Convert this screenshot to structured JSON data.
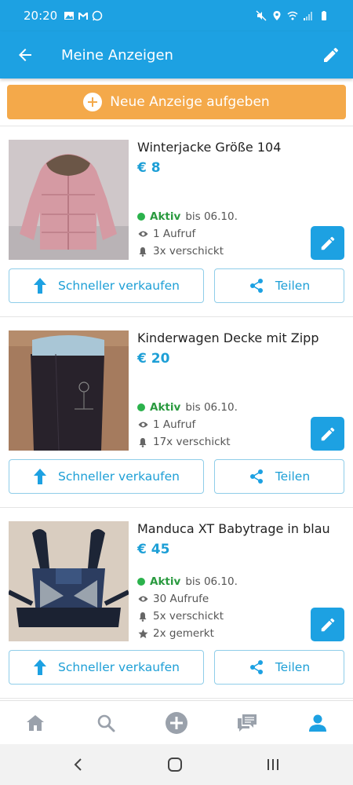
{
  "status_bar": {
    "time": "20:20"
  },
  "app_bar": {
    "title": "Meine Anzeigen"
  },
  "new_ad_button": {
    "label": "Neue Anzeige aufgeben"
  },
  "listings": [
    {
      "title": "Winterjacke Größe 104",
      "price": "€ 8",
      "status": "Aktiv",
      "until": "bis 06.10.",
      "views": "1 Aufruf",
      "sent": "3x verschickt",
      "sell_label": "Schneller verkaufen",
      "share_label": "Teilen"
    },
    {
      "title": "Kinderwagen Decke mit Zipp",
      "price": "€ 20",
      "status": "Aktiv",
      "until": "bis 06.10.",
      "views": "1 Aufruf",
      "sent": "17x verschickt",
      "sell_label": "Schneller verkaufen",
      "share_label": "Teilen"
    },
    {
      "title": "Manduca XT Babytrage in blau",
      "price": "€ 45",
      "status": "Aktiv",
      "until": "bis 06.10.",
      "views": "30 Aufrufe",
      "sent": "5x verschickt",
      "saved": "2x gemerkt",
      "sell_label": "Schneller verkaufen",
      "share_label": "Teilen"
    }
  ],
  "bottom_nav": [
    "home-icon",
    "search-icon",
    "add-circle-icon",
    "messages-icon",
    "profile-icon"
  ],
  "colors": {
    "primary": "#1da1e2",
    "accent_orange": "#f4a94a",
    "active_green": "#2bb24c",
    "price_blue": "#1d9fd6"
  }
}
